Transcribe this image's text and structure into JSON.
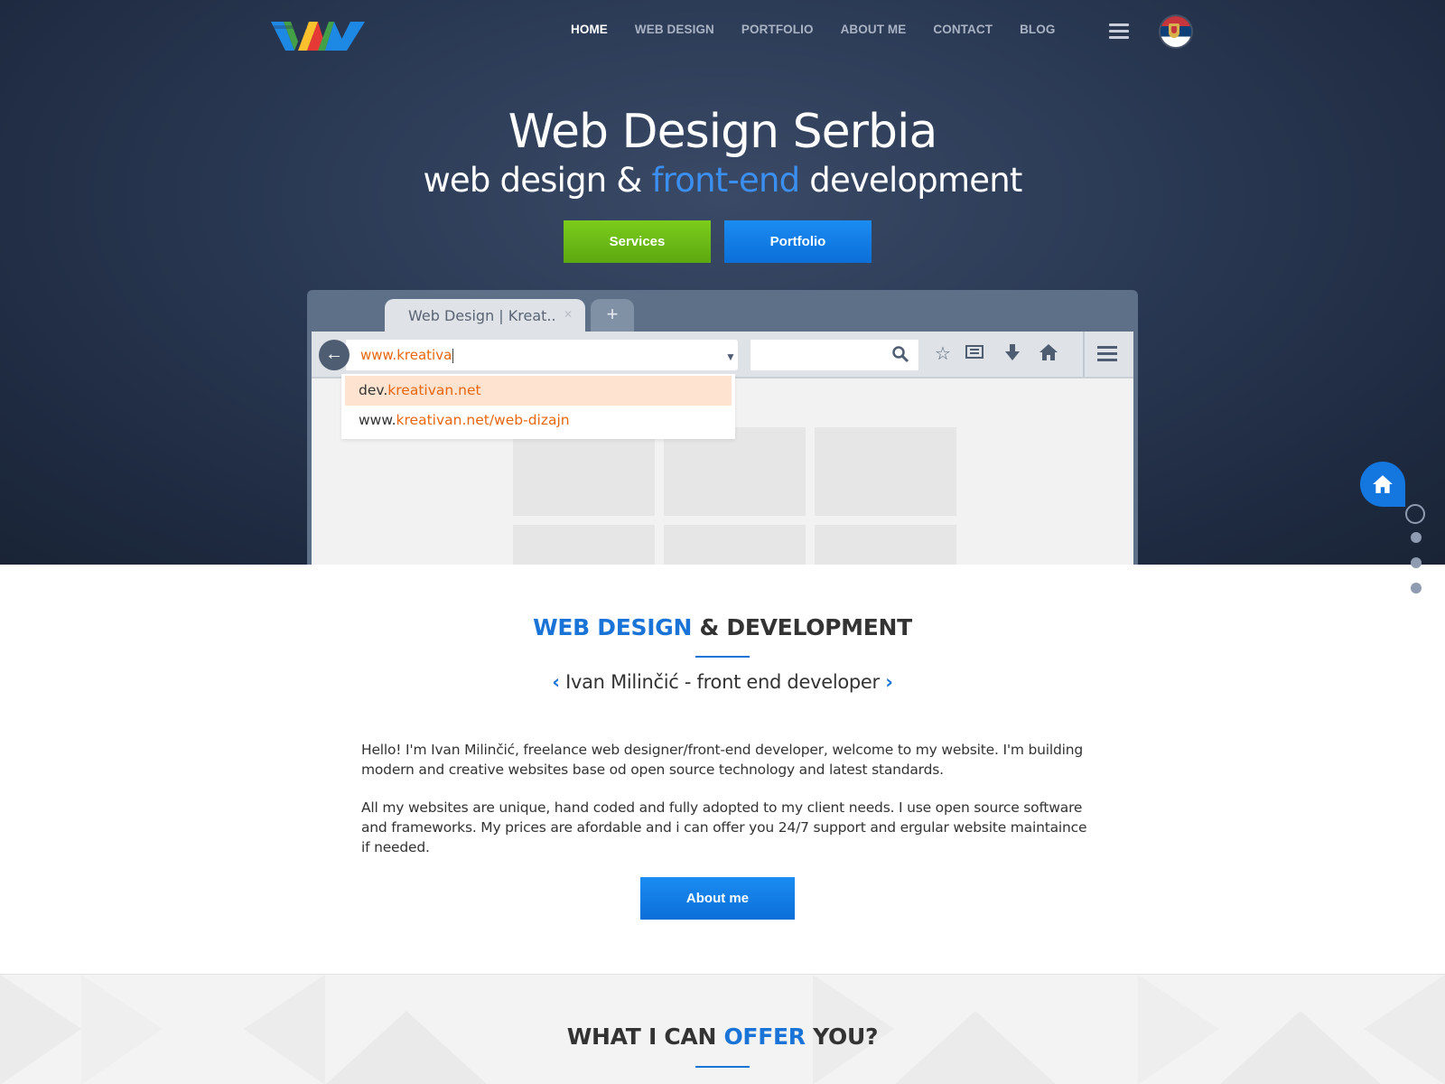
{
  "nav": {
    "items": [
      "HOME",
      "WEB DESIGN",
      "PORTFOLIO",
      "ABOUT ME",
      "CONTACT",
      "BLOG"
    ],
    "active": "HOME"
  },
  "hero": {
    "title": "Web Design Serbia",
    "subtitle_pre": "web design & ",
    "subtitle_highlight": "front-end",
    "subtitle_post": " development",
    "services_button": "Services",
    "portfolio_button": "Portfolio"
  },
  "browser_mockup": {
    "tab_title": "Web Design | Kreat..",
    "new_tab": "+",
    "url_value": "www.kreativa",
    "suggestions": [
      {
        "prefix": "dev.",
        "match": "kreativan.net"
      },
      {
        "prefix": "www.",
        "match": "kreativan.net/web-dizajn"
      }
    ]
  },
  "about": {
    "title_highlight": "WEB DESIGN",
    "title_rest": " & DEVELOPMENT",
    "subtitle": "Ivan Milinčić - front end developer",
    "paragraph1": "Hello! I'm Ivan Milinčić, freelance web designer/front-end developer, welcome to my website. I'm building modern and creative websites base od open source technology and latest standards.",
    "paragraph2": "All my websites are unique, hand coded and fully adopted to my client needs. I use open source software and frameworks. My prices are afordable and i can offer you 24/7 support and ergular website maintaince if needed.",
    "button": "About me"
  },
  "offer": {
    "title_pre": "WHAT I CAN ",
    "title_highlight": "OFFER",
    "title_post": " YOU?"
  },
  "colors": {
    "accent_blue": "#1a74d8",
    "services_green": "#6cbb14",
    "url_orange": "#e8660c"
  },
  "icons": [
    "logo",
    "hamburger-icon",
    "serbia-flag-icon",
    "back-arrow-icon",
    "dropdown-arrow-icon",
    "reload-icon",
    "search-icon",
    "star-icon",
    "reading-list-icon",
    "download-icon",
    "home-icon",
    "menu-icon",
    "home-float-icon"
  ]
}
